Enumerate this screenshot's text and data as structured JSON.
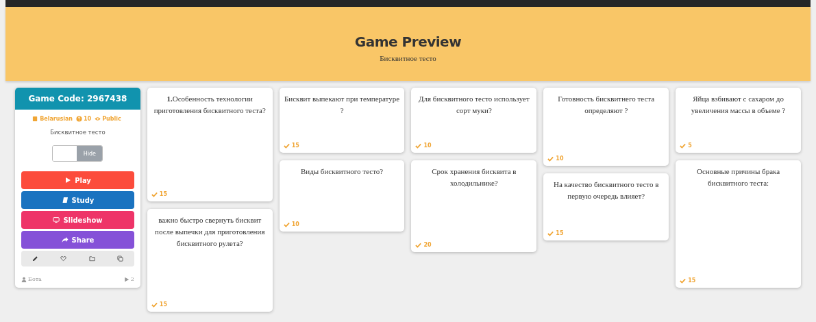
{
  "header": {
    "title": "Game Preview",
    "subtitle": "Бисквитное тесто"
  },
  "game": {
    "code_label": "Game Code: 2967438",
    "language": "Belarusian",
    "question_count": "10",
    "visibility": "Public",
    "name": "Бисквитное тесто",
    "toggle": {
      "label": "Hide",
      "on": false
    },
    "buttons": [
      {
        "kind": "play",
        "label": "Play",
        "color": "#fc4c3c"
      },
      {
        "kind": "study",
        "label": "Study",
        "color": "#1a73c0"
      },
      {
        "kind": "slideshow",
        "label": "Slideshow",
        "color": "#ee3468"
      },
      {
        "kind": "share",
        "label": "Share",
        "color": "#8551d8"
      }
    ],
    "author": "Бота",
    "plays": "2"
  },
  "columns": [
    [
      {
        "question": "**1.**Особенность технологии приготовления бисквитного теста?",
        "points": "15"
      },
      {
        "question": "важно быстро свернуть бисквит после выпечки для приготовления бисквитного рулета?",
        "points": "15"
      }
    ],
    [
      {
        "question": "Бисквит выпекают при температуре ?",
        "points": "15"
      },
      {
        "question": "Виды бисквитного тесто?",
        "points": "10"
      }
    ],
    [
      {
        "question": "Для бисквитного тесто использует сорт муки?",
        "points": "10"
      },
      {
        "question": "Срок хранения бисквита в холодильнике?",
        "points": "20"
      }
    ],
    [
      {
        "question": "Готовность бисквитнего теста определяют ?",
        "points": "10"
      },
      {
        "question": "На качество бисквитного тесто в первую очередь влияет?",
        "points": "15"
      }
    ],
    [
      {
        "question": "Яйца взбивают с сахаром до увеличения массы в объеме ?",
        "points": "5"
      },
      {
        "question": "Основные причины брака бисквитного теста:",
        "points": "15"
      }
    ]
  ]
}
